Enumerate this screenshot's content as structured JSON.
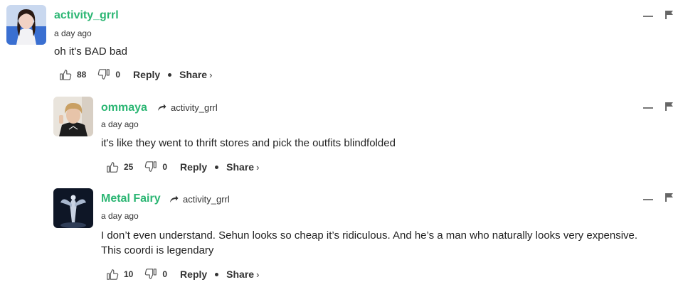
{
  "comments": [
    {
      "username": "activity_grrl",
      "reply_to": "",
      "time": "a day ago",
      "text": "oh it's BAD bad",
      "likes": "88",
      "dislikes": "0",
      "reply_label": "Reply",
      "share_label": "Share",
      "avatar_icon": "user-avatar-photo"
    },
    {
      "username": "ommaya",
      "reply_to": "activity_grrl",
      "time": "a day ago",
      "text": "it's like they went to thrift stores and pick the outfits blindfolded",
      "likes": "25",
      "dislikes": "0",
      "reply_label": "Reply",
      "share_label": "Share",
      "avatar_icon": "user-avatar-photo"
    },
    {
      "username": "Metal Fairy",
      "reply_to": "activity_grrl",
      "time": "a day ago",
      "text_line1": "I don’t even understand. Sehun looks so cheap it’s ridiculous. And he’s a man who naturally looks very expensive.",
      "text_line2": "This coordi is legendary",
      "likes": "10",
      "dislikes": "0",
      "reply_label": "Reply",
      "share_label": "Share",
      "avatar_icon": "user-avatar-photo"
    }
  ],
  "colors": {
    "username": "#2bb673",
    "text": "#222222",
    "muted": "#777777"
  }
}
